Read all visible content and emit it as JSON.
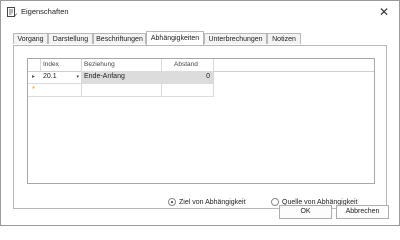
{
  "window": {
    "title": "Eigenschaften",
    "icon": "properties-icon",
    "close_icon": "close-icon",
    "close_glyph": "✕"
  },
  "tabs": [
    {
      "label": "Vorgang",
      "active": false
    },
    {
      "label": "Darstellung",
      "active": false
    },
    {
      "label": "Beschriftungen",
      "active": false
    },
    {
      "label": "Abhängigkeiten",
      "active": true
    },
    {
      "label": "Unterbrechungen",
      "active": false
    },
    {
      "label": "Notizen",
      "active": false
    }
  ],
  "grid": {
    "columns": [
      "Index",
      "Beziehung",
      "Abstand"
    ],
    "rows": [
      {
        "indicator": "▸",
        "index": "20.1",
        "beziehung": "Ende-Anfang",
        "abstand": "0"
      }
    ],
    "new_row_indicator": "*",
    "dropdown_glyph": "▾"
  },
  "options": {
    "ziel_label": "Ziel von Abhängigkeit",
    "quelle_label": "Quelle von Abhängigkeit",
    "selected": "ziel"
  },
  "buttons": {
    "ok_label": "OK",
    "cancel_label": "Abbrechen"
  }
}
